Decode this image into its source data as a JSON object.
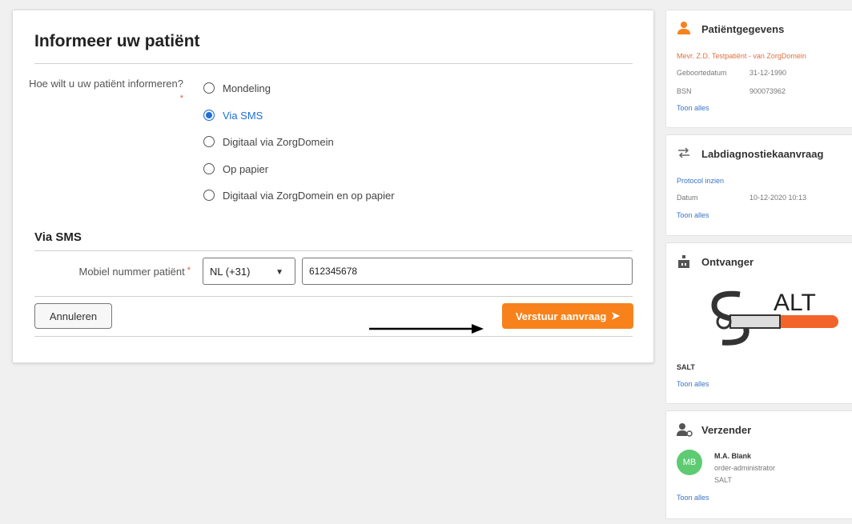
{
  "form": {
    "title": "Informeer uw patiënt",
    "question": "Hoe wilt u uw patiënt informeren?",
    "required_mark": "*",
    "options": [
      {
        "label": "Mondeling",
        "checked": false
      },
      {
        "label": "Via SMS",
        "checked": true
      },
      {
        "label": "Digitaal via ZorgDomein",
        "checked": false
      },
      {
        "label": "Op papier",
        "checked": false
      },
      {
        "label": "Digitaal via ZorgDomein en op papier",
        "checked": false
      }
    ],
    "section_title": "Via SMS",
    "phone_label": "Mobiel nummer patiënt",
    "country_code": "NL (+31)",
    "phone_value": "612345678",
    "cancel_label": "Annuleren",
    "send_label": "Verstuur aanvraag"
  },
  "patient": {
    "title": "Patiëntgegevens",
    "name": "Mevr. Z.D. Testpatiënt - van ZorgDomein",
    "dob_label": "Geboortedatum",
    "dob_value": "31-12-1990",
    "bsn_label": "BSN",
    "bsn_value": "900073962",
    "show_all": "Toon alles"
  },
  "lab": {
    "title": "Labdiagnostiekaanvraag",
    "protocol_link": "Protocol inzien",
    "date_label": "Datum",
    "date_value": "10-12-2020 10:13",
    "show_all": "Toon alles"
  },
  "receiver": {
    "title": "Ontvanger",
    "logo_text": "ALT",
    "name": "SALT",
    "show_all": "Toon alles"
  },
  "sender": {
    "title": "Verzender",
    "initials": "MB",
    "name": "M.A. Blank",
    "role": "order-administrator",
    "org": "SALT",
    "show_all": "Toon alles"
  },
  "colors": {
    "accent": "#f7821b",
    "link": "#3a74c4",
    "radio_checked": "#1e6fd9",
    "avatar": "#5ecb72"
  }
}
